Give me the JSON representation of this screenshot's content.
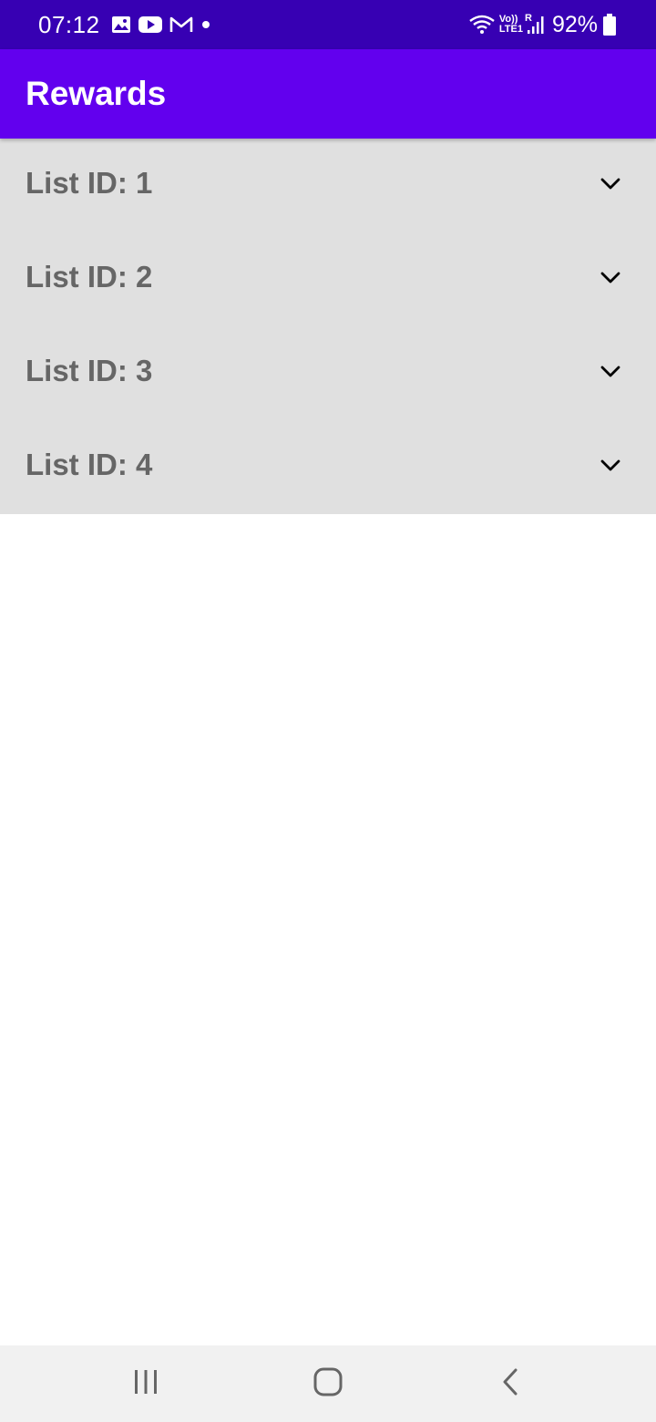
{
  "status_bar": {
    "time": "07:12",
    "battery": "92%",
    "network_top": "Vo))",
    "network_bottom": "LTE1",
    "roaming": "R",
    "icons": [
      "gallery-icon",
      "youtube-icon",
      "gmail-icon",
      "notification-dot-icon",
      "wifi-icon",
      "signal-icon",
      "battery-icon"
    ]
  },
  "app_bar": {
    "title": "Rewards"
  },
  "list": {
    "items": [
      {
        "label": "List ID: 1",
        "icon": "chevron-down-icon"
      },
      {
        "label": "List ID: 2",
        "icon": "chevron-down-icon"
      },
      {
        "label": "List ID: 3",
        "icon": "chevron-down-icon"
      },
      {
        "label": "List ID: 4",
        "icon": "chevron-down-icon"
      }
    ]
  },
  "nav_bar": {
    "buttons": [
      "recent-apps-icon",
      "home-icon",
      "back-icon"
    ]
  },
  "colors": {
    "status_bar": "#3700b3",
    "app_bar": "#6200ee",
    "list_background": "#e0e0e0",
    "list_text": "#666666",
    "nav_bar": "#f1f1f1"
  }
}
